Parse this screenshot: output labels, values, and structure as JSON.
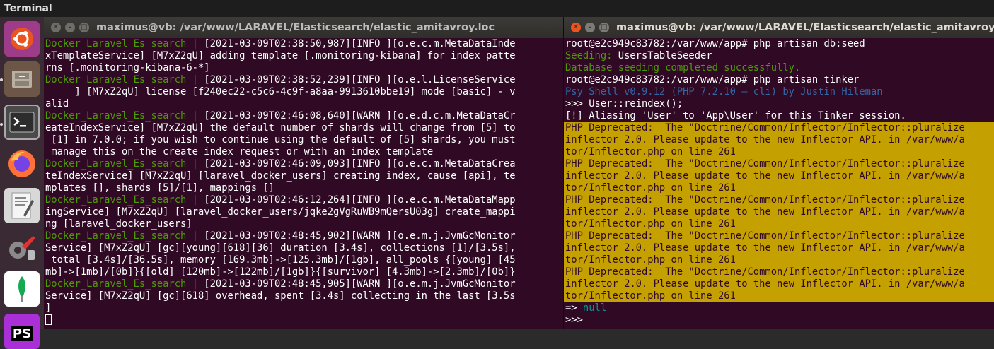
{
  "app": {
    "title": "Terminal"
  },
  "launcher": {
    "items": [
      {
        "name": "ubuntu-icon"
      },
      {
        "name": "files-icon"
      },
      {
        "name": "terminal-icon"
      },
      {
        "name": "firefox-icon"
      },
      {
        "name": "text-editor-icon"
      },
      {
        "name": "settings-icon"
      },
      {
        "name": "mongodb-icon"
      },
      {
        "name": "phpstorm-icon",
        "label": "PS"
      }
    ]
  },
  "left_window": {
    "title": "maximus@vb: /var/www/LARAVEL/Elasticsearch/elastic_amitavroy.loc",
    "lines": [
      [
        {
          "t": "Docker_Laravel_Es_search | ",
          "c": "g"
        },
        {
          "t": "[2021-03-09T02:38:50,987][INFO ][o.e.c.m.MetaDataInde"
        }
      ],
      [
        {
          "t": "xTemplateService] [M7xZ2qU] adding template [.monitoring-kibana] for index patte"
        }
      ],
      [
        {
          "t": "rns [.monitoring-kibana-6-*]"
        }
      ],
      [
        {
          "t": "Docker_Laravel_Es_search | ",
          "c": "g"
        },
        {
          "t": "[2021-03-09T02:38:52,239][INFO ][o.e.l.LicenseService"
        }
      ],
      [
        {
          "t": "     ] [M7xZ2qU] license [f240ec22-c5c6-4c9f-a8aa-9913610bbe19] mode [basic] - v"
        }
      ],
      [
        {
          "t": "alid"
        }
      ],
      [
        {
          "t": "Docker_Laravel_Es_search | ",
          "c": "g"
        },
        {
          "t": "[2021-03-09T02:46:08,640][WARN ][o.e.d.c.m.MetaDataCr"
        }
      ],
      [
        {
          "t": "eateIndexService] [M7xZ2qU] the default number of shards will change from [5] to"
        }
      ],
      [
        {
          "t": " [1] in 7.0.0; if you wish to continue using the default of [5] shards, you must"
        }
      ],
      [
        {
          "t": " manage this on the create index request or with an index template"
        }
      ],
      [
        {
          "t": "Docker_Laravel_Es_search | ",
          "c": "g"
        },
        {
          "t": "[2021-03-09T02:46:09,093][INFO ][o.e.c.m.MetaDataCrea"
        }
      ],
      [
        {
          "t": "teIndexService] [M7xZ2qU] [laravel_docker_users] creating index, cause [api], te"
        }
      ],
      [
        {
          "t": "mplates [], shards [5]/[1], mappings []"
        }
      ],
      [
        {
          "t": "Docker_Laravel_Es_search | ",
          "c": "g"
        },
        {
          "t": "[2021-03-09T02:46:12,264][INFO ][o.e.c.m.MetaDataMapp"
        }
      ],
      [
        {
          "t": "ingService] [M7xZ2qU] [laravel_docker_users/jqke2gVgRuWB9mQersU03g] create_mappi"
        }
      ],
      [
        {
          "t": "ng [laravel_docker_users]"
        }
      ],
      [
        {
          "t": "Docker_Laravel_Es_search | ",
          "c": "g"
        },
        {
          "t": "[2021-03-09T02:48:45,902][WARN ][o.e.m.j.JvmGcMonitor"
        }
      ],
      [
        {
          "t": "Service] [M7xZ2qU] [gc][young][618][36] duration [3.4s], collections [1]/[3.5s],"
        }
      ],
      [
        {
          "t": " total [3.4s]/[36.5s], memory [169.3mb]->[125.3mb]/[1gb], all_pools {[young] [45"
        }
      ],
      [
        {
          "t": "mb]->[1mb]/[0b]}{[old] [120mb]->[122mb]/[1gb]}{[survivor] [4.3mb]->[2.3mb]/[0b]}"
        }
      ],
      [
        {
          "t": "Docker_Laravel_Es_search | ",
          "c": "g"
        },
        {
          "t": "[2021-03-09T02:48:45,905][WARN ][o.e.m.j.JvmGcMonitor"
        }
      ],
      [
        {
          "t": "Service] [M7xZ2qU] [gc][618] overhead, spent [3.4s] collecting in the last [3.5s"
        }
      ],
      [
        {
          "t": "]"
        }
      ]
    ]
  },
  "right_window": {
    "title": "maximus@vb: /var/www/LARAVEL/Elasticsearch/elastic_amitavroy.loc",
    "lines": [
      [
        {
          "t": "root@e2c949c83782:/var/www/app# php artisan db:seed"
        }
      ],
      [
        {
          "t": "Seeding:",
          "c": "g"
        },
        {
          "t": " UsersTableSeeder"
        }
      ],
      [
        {
          "t": "Database seeding completed successfully.",
          "c": "g"
        }
      ],
      [
        {
          "t": "root@e2c949c83782:/var/www/app# php artisan tinker"
        }
      ],
      [
        {
          "t": "Psy Shell v0.9.12 (PHP 7.2.10 — cli) by Justin Hileman",
          "c": "b"
        }
      ],
      [
        {
          "t": ">>> User::reindex();"
        }
      ],
      [
        {
          "t": "[!] Aliasing 'User' to 'App\\User' for this Tinker session."
        }
      ],
      [
        {
          "t": "PHP Deprecated:  The \"Doctrine/Common/Inflector/Inflector::pluralize",
          "c": "dep"
        }
      ],
      [
        {
          "t": "inflector 2.0. Please update to the new Inflector API. in /var/www/a",
          "c": "dep"
        }
      ],
      [
        {
          "t": "tor/Inflector.php on line 261",
          "c": "dep"
        }
      ],
      [
        {
          "t": "PHP Deprecated:  The \"Doctrine/Common/Inflector/Inflector::pluralize",
          "c": "dep"
        }
      ],
      [
        {
          "t": "inflector 2.0. Please update to the new Inflector API. in /var/www/a",
          "c": "dep"
        }
      ],
      [
        {
          "t": "tor/Inflector.php on line 261",
          "c": "dep"
        }
      ],
      [
        {
          "t": "PHP Deprecated:  The \"Doctrine/Common/Inflector/Inflector::pluralize",
          "c": "dep"
        }
      ],
      [
        {
          "t": "inflector 2.0. Please update to the new Inflector API. in /var/www/a",
          "c": "dep"
        }
      ],
      [
        {
          "t": "tor/Inflector.php on line 261",
          "c": "dep"
        }
      ],
      [
        {
          "t": "PHP Deprecated:  The \"Doctrine/Common/Inflector/Inflector::pluralize",
          "c": "dep"
        }
      ],
      [
        {
          "t": "inflector 2.0. Please update to the new Inflector API. in /var/www/a",
          "c": "dep"
        }
      ],
      [
        {
          "t": "tor/Inflector.php on line 261",
          "c": "dep"
        }
      ],
      [
        {
          "t": "PHP Deprecated:  The \"Doctrine/Common/Inflector/Inflector::pluralize",
          "c": "dep"
        }
      ],
      [
        {
          "t": "inflector 2.0. Please update to the new Inflector API. in /var/www/a",
          "c": "dep"
        }
      ],
      [
        {
          "t": "tor/Inflector.php on line 261",
          "c": "dep"
        }
      ],
      [
        {
          "t": "=> "
        },
        {
          "t": "null",
          "c": "c"
        }
      ],
      [
        {
          "t": ">>>"
        }
      ]
    ]
  },
  "colors": {
    "terminal_bg": "#300a24",
    "green": "#4e9a06",
    "blue": "#3465a4",
    "cyan": "#06989a",
    "deprecated_bg": "#c4a000",
    "close_button": "#e95420"
  }
}
